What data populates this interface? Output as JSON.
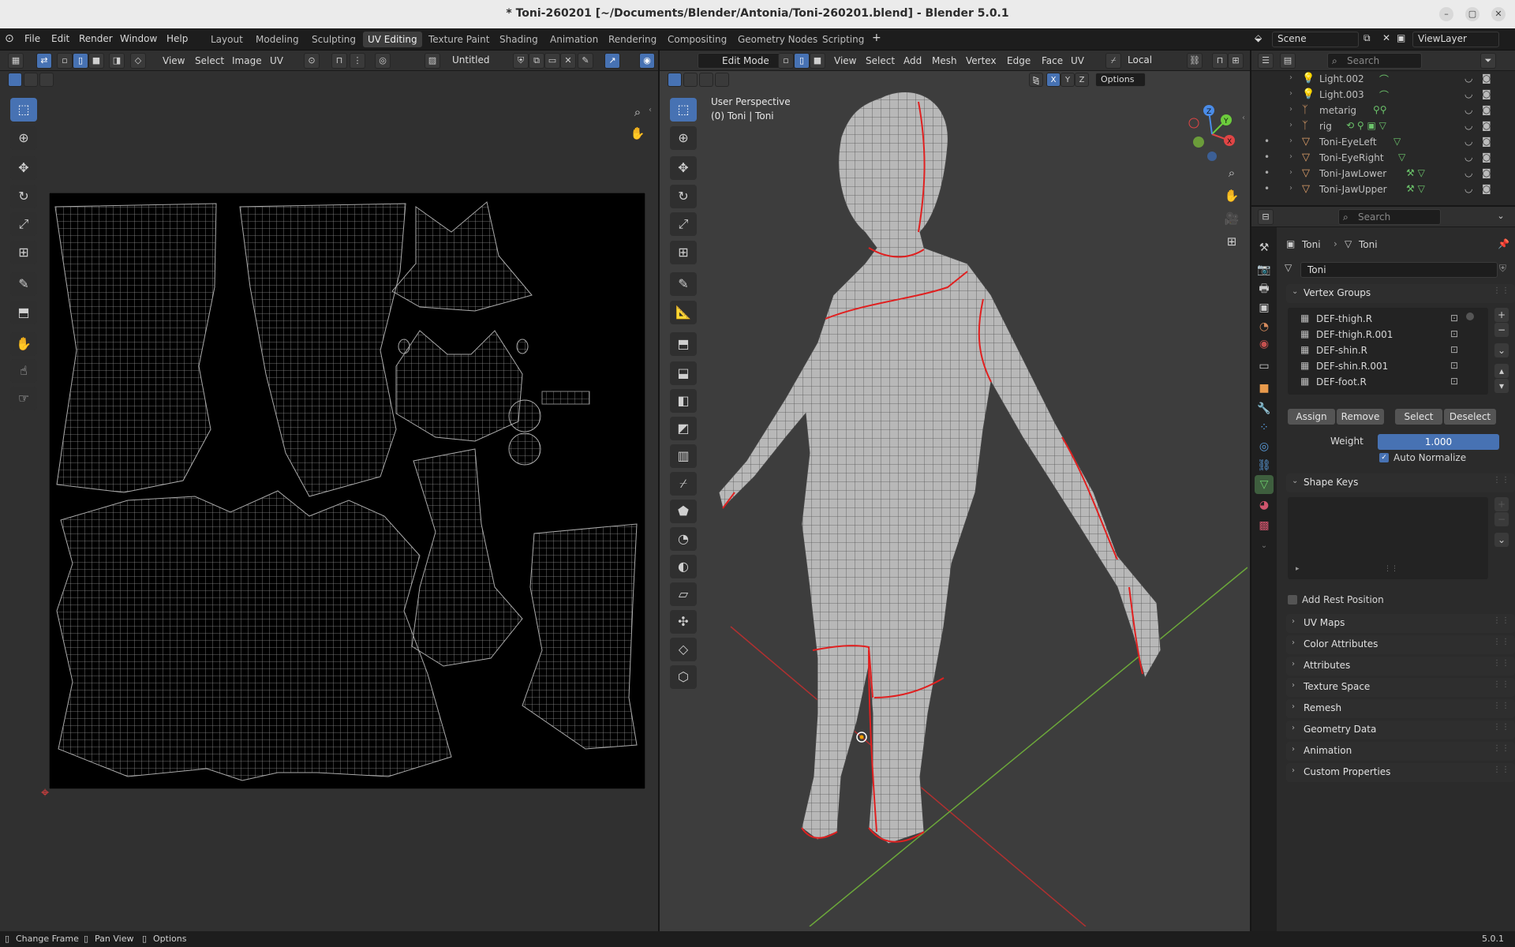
{
  "window": {
    "title": "* Toni-260201 [~/Documents/Blender/Antonia/Toni-260201.blend] - Blender 5.0.1"
  },
  "menu": [
    "File",
    "Edit",
    "Render",
    "Window",
    "Help"
  ],
  "workspaces": [
    "Layout",
    "Modeling",
    "Sculpting",
    "UV Editing",
    "Texture Paint",
    "Shading",
    "Animation",
    "Rendering",
    "Compositing",
    "Geometry Nodes",
    "Scripting"
  ],
  "active_workspace": "UV Editing",
  "scene": {
    "name": "Scene",
    "view_layer": "ViewLayer"
  },
  "uv_editor": {
    "menus": [
      "View",
      "Select",
      "Image",
      "UV"
    ],
    "image_name": "Untitled"
  },
  "viewport": {
    "mode": "Edit Mode",
    "menus": [
      "View",
      "Select",
      "Add",
      "Mesh",
      "Vertex",
      "Edge",
      "Face",
      "UV"
    ],
    "transform_orientation": "Local",
    "axes": [
      "X",
      "Y",
      "Z"
    ],
    "options_label": "Options",
    "overlay_line1": "User Perspective",
    "overlay_line2": "(0) Toni | Toni",
    "gizmo": {
      "x": "X",
      "y": "Y",
      "z": "Z"
    }
  },
  "outliner": {
    "search_placeholder": "Search",
    "items": [
      "Light.002",
      "Light.003",
      "metarig",
      "rig",
      "Toni-EyeLeft",
      "Toni-EyeRight",
      "Toni-JawLower",
      "Toni-JawUpper"
    ]
  },
  "properties": {
    "search_placeholder": "Search",
    "breadcrumb": [
      "Toni",
      "Toni"
    ],
    "mesh_name": "Toni",
    "vertex_groups": {
      "title": "Vertex Groups",
      "items": [
        "DEF-thigh.R",
        "DEF-thigh.R.001",
        "DEF-shin.R",
        "DEF-shin.R.001",
        "DEF-foot.R"
      ],
      "buttons": [
        "Assign",
        "Remove",
        "Select",
        "Deselect"
      ],
      "weight_label": "Weight",
      "weight_value": "1.000",
      "auto_normalize": "Auto Normalize"
    },
    "shape_keys": {
      "title": "Shape Keys",
      "add_rest": "Add Rest Position"
    },
    "panels": [
      "UV Maps",
      "Color Attributes",
      "Attributes",
      "Texture Space",
      "Remesh",
      "Geometry Data",
      "Animation",
      "Custom Properties"
    ]
  },
  "statusbar": {
    "items": [
      "Change Frame",
      "Pan View",
      "Options"
    ],
    "version": "5.0.1"
  },
  "colors": {
    "accent": "#4772b3",
    "seam": "#e02020",
    "mesh": "#8a8a8a",
    "bg": "#303030"
  }
}
